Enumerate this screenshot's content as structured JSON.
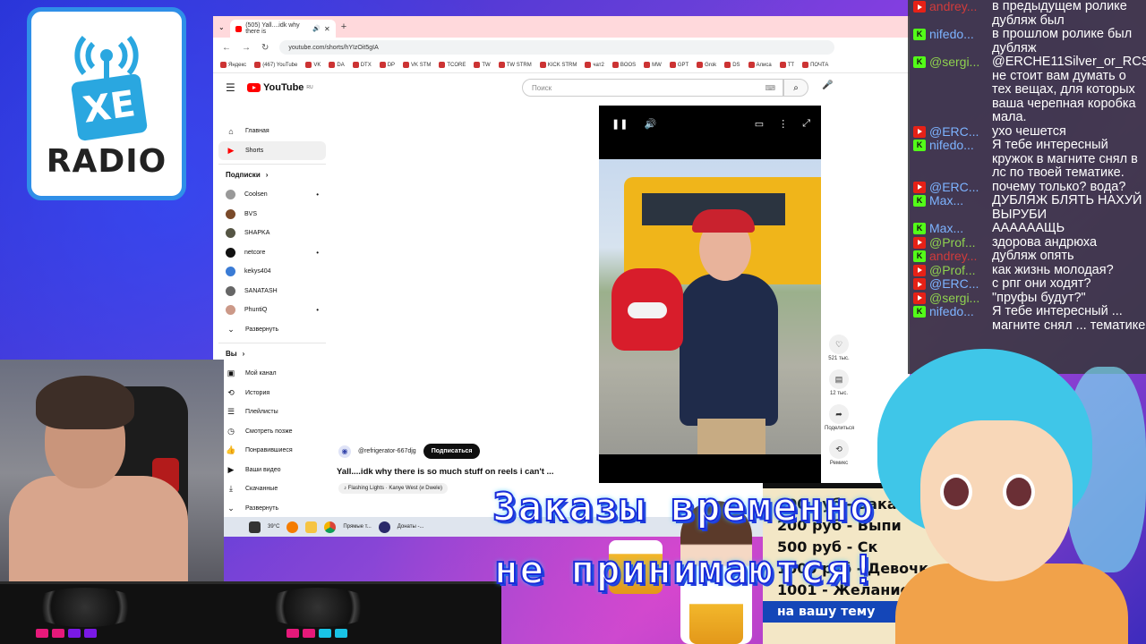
{
  "logo": {
    "text": "RADIO",
    "box_text": "XE"
  },
  "browser": {
    "tab_title": "(505) Yall....idk why there is",
    "url": "youtube.com/shorts/hYIzOit5gIA",
    "bookmarks": [
      "Яндекс",
      "(467) YouTube",
      "VK",
      "DA",
      "DTX",
      "DP",
      "VK STM",
      "TCORE",
      "TW",
      "TW STRM",
      "KICK STRM",
      "чат2",
      "BOOS",
      "MW",
      "GPT",
      "Grok",
      "DS",
      "Алиса",
      "TT",
      "ПОЧТА"
    ]
  },
  "youtube": {
    "logo": "YouTube",
    "region": "RU",
    "search_placeholder": "Поиск",
    "nav": [
      {
        "label": "Главная",
        "icon": "home-icon"
      },
      {
        "label": "Shorts",
        "icon": "shorts-icon"
      }
    ],
    "subs_title": "Подписки",
    "subs": [
      "Coolsen",
      "BVS",
      "SHAPKA",
      "netcore",
      "kekys404",
      "SANATASH",
      "PhuntiQ"
    ],
    "expand_label": "Развернуть",
    "you_title": "Вы",
    "you_items": [
      "Мой канал",
      "История",
      "Плейлисты",
      "Смотреть позже",
      "Понравившиеся",
      "Ваши видео",
      "Скачанные",
      "Развернуть"
    ],
    "channel": "@refrigerator-667djg",
    "subscribe": "Подписаться",
    "video_title": "Yall....idk why there is so much stuff on reels i can't ...",
    "music": "Flashing Lights · Kanye West (и Dwele)",
    "actions": [
      {
        "icon": "heart-icon",
        "label": "521 тыс."
      },
      {
        "icon": "comment-icon",
        "label": "12 тыс."
      },
      {
        "icon": "share-icon",
        "label": "Поделиться"
      },
      {
        "icon": "remix-icon",
        "label": "Ремикс"
      }
    ]
  },
  "taskbar": {
    "weather": "39°C",
    "items": [
      "Прямые т...",
      "Донаты -..."
    ]
  },
  "chat": [
    {
      "platform": "yt",
      "user": "andrey...",
      "user_color": "#d13b3b",
      "text": "в предыдущем ролике дубляж был"
    },
    {
      "platform": "kick",
      "user": "nifedo...",
      "user_color": "#7db3ff",
      "text": "в прошлом ролике был дубляж"
    },
    {
      "platform": "kick",
      "user": "@sergi...",
      "user_color": "#8fd14f",
      "text": "@ERCHE11Silver_or_RCS, не стоит вам думать о тех вещах, для которых ваша черепная коробка мала."
    },
    {
      "platform": "yt",
      "user": "@ERC...",
      "user_color": "#7db3ff",
      "text": "ухо чешется"
    },
    {
      "platform": "kick",
      "user": "nifedo...",
      "user_color": "#7db3ff",
      "text": "Я тебе интересный кружок в магните снял в лс по твоей тематике."
    },
    {
      "platform": "yt",
      "user": "@ERC...",
      "user_color": "#7db3ff",
      "text": "почему только? вода?"
    },
    {
      "platform": "kick",
      "user": "Max...",
      "user_color": "#7db3ff",
      "text": "ДУБЛЯЖ БЛЯТЬ НАХУЙ ВЫРУБИ"
    },
    {
      "platform": "kick",
      "user": "Max...",
      "user_color": "#7db3ff",
      "text": "ААААААЩЬ"
    },
    {
      "platform": "yt",
      "user": "@Prof...",
      "user_color": "#8fd14f",
      "text": "здорова андрюха"
    },
    {
      "platform": "kick",
      "user": "andrey...",
      "user_color": "#d13b3b",
      "text": "дубляж опять"
    },
    {
      "platform": "yt",
      "user": "@Prof...",
      "user_color": "#8fd14f",
      "text": "как жизнь молодая?"
    },
    {
      "platform": "yt",
      "user": "@ERC...",
      "user_color": "#7db3ff",
      "text": "с рпг они ходят?"
    },
    {
      "platform": "yt",
      "user": "@sergi...",
      "user_color": "#8fd14f",
      "text": "\"пруфы будут?\""
    },
    {
      "platform": "kick",
      "user": "nifedo...",
      "user_color": "#7db3ff",
      "text": "Я тебе интересный ... магните снял ... тематике"
    }
  ],
  "overlay": {
    "line1": "Заказы временно",
    "line2": "не принимаются!"
  },
  "price_list": [
    "100 руб - Заказ",
    "200 руб - Выпи",
    "500 руб - Ск",
    "1000 руб - Девочк",
    "1001 - Желание (",
    "на вашу тему"
  ]
}
